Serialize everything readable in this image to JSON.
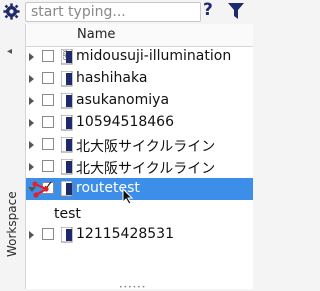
{
  "toolbar": {
    "search_placeholder": "start typing...",
    "help_label": "?",
    "gear_icon": "gear-icon",
    "filter_icon": "filter-icon"
  },
  "sidebar": {
    "label": "Workspace"
  },
  "table": {
    "column_name": "Name"
  },
  "layers": [
    {
      "label": "midousuji-illumination",
      "checked": false,
      "expanded": false,
      "selected": false
    },
    {
      "label": "hashihaka",
      "checked": false,
      "expanded": false,
      "selected": false
    },
    {
      "label": "asukanomiya",
      "checked": false,
      "expanded": false,
      "selected": false
    },
    {
      "label": "10594518466",
      "checked": false,
      "expanded": false,
      "selected": false
    },
    {
      "label": "北大阪サイクルライン",
      "checked": false,
      "expanded": false,
      "selected": false
    },
    {
      "label": "北大阪サイクルライン",
      "checked": false,
      "expanded": false,
      "selected": false
    },
    {
      "label": "routetest",
      "checked": true,
      "expanded": true,
      "selected": true
    },
    {
      "label": "12115428531",
      "checked": false,
      "expanded": false,
      "selected": false
    }
  ],
  "track": {
    "label": "test"
  },
  "colors": {
    "selection": "#3d8ee8",
    "accent_blue": "#1f2a6b",
    "track_red": "#e0222a"
  }
}
